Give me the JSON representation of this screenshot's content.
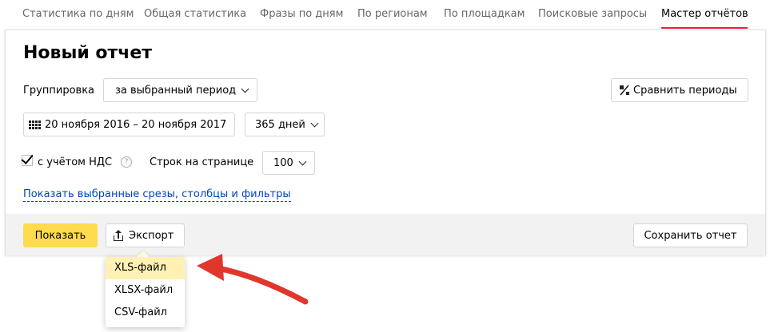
{
  "tabs": [
    {
      "label": "Статистика по дням"
    },
    {
      "label": "Общая статистика"
    },
    {
      "label": "Фразы по дням"
    },
    {
      "label": "По регионам"
    },
    {
      "label": "По площадкам"
    },
    {
      "label": "Поисковые запросы"
    },
    {
      "label": "Мастер отчётов",
      "active": true
    }
  ],
  "report": {
    "title": "Новый отчет",
    "grouping_label": "Группировка",
    "grouping_value": "за выбранный период",
    "compare_button": "Сравнить периоды",
    "date_range": "20 ноября 2016 – 20 ноября 2017",
    "period_value": "365 дней",
    "vat_label": "с учётом НДС",
    "vat_checked": true,
    "help_glyph": "?",
    "rows_label": "Строк на странице",
    "rows_value": "100",
    "show_slices_link": "Показать выбранные срезы, столбцы и фильтры"
  },
  "footer": {
    "show_button": "Показать",
    "export_button": "Экспорт",
    "save_button": "Сохранить отчет"
  },
  "export_menu": {
    "items": [
      {
        "label": "XLS-файл",
        "highlighted": true
      },
      {
        "label": "XLSX-файл"
      },
      {
        "label": "CSV-файл"
      }
    ]
  },
  "colors": {
    "accent_red": "#e8243c",
    "button_yellow": "#ffdb4d",
    "link_blue": "#0044bb",
    "annotation_arrow": "#e0362c"
  }
}
